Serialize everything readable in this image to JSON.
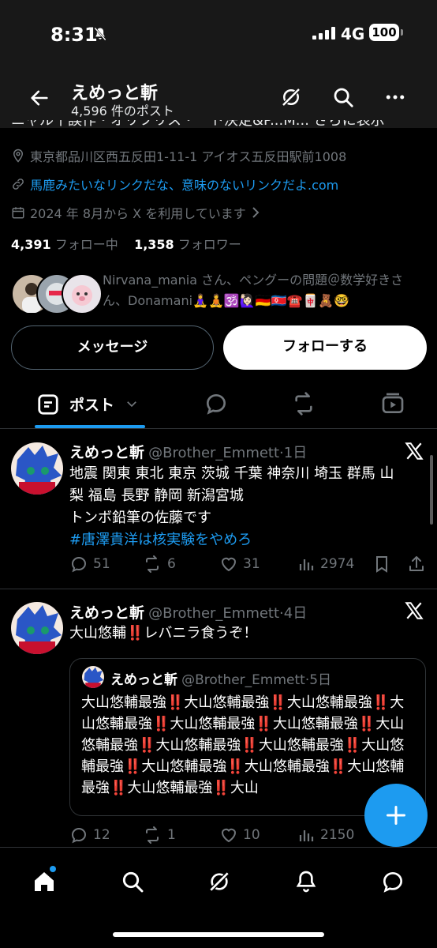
{
  "status_bar": {
    "time": "8:31",
    "network": "4G",
    "battery": "100"
  },
  "header": {
    "title": "えめっと斬",
    "subtitle": "4,596 件のポスト"
  },
  "profile": {
    "bio_cut": "ニャル十誤作・オリフリス・ート決定&P...M... さらに表示",
    "location": "東京都品川区西五反田1-11-1 アイオス五反田駅前1008",
    "website": "馬鹿みたいなリンクだな、意味のないリンクだよ.com",
    "joined": "2024 年 8月から X を利用しています",
    "following_count": "4,391",
    "following_label": "フォロー中",
    "followers_count": "1,358",
    "followers_label": "フォロワー",
    "followed_by": "Nirvana_mania さん、ペングーの問題＠数学好きさん、Donamani🧘‍♀️🧘🕉️🙋🏻‍♀️🇩🇪🇰🇵☎️🀄🧸🤓"
  },
  "buttons": {
    "message": "メッセージ",
    "follow": "フォローする"
  },
  "tabs": {
    "posts_label": "ポスト"
  },
  "posts": [
    {
      "name": "えめっと斬",
      "handle": "@Brother_Emmett",
      "time": "·1日",
      "lines": [
        "地震 関東 東北 東京 茨城 千葉 神奈川 埼玉 群馬 山",
        "梨 福島 長野 静岡 新潟宮城",
        "トンボ鉛筆の佐藤です"
      ],
      "hashtag": "#唐澤貴洋は核実験をやめろ",
      "replies": "51",
      "reposts": "6",
      "likes": "31",
      "views": "2974"
    },
    {
      "name": "えめっと斬",
      "handle": "@Brother_Emmett",
      "time": "·4日",
      "text": "大山悠輔‼️レバニラ食うぞ！",
      "quote": {
        "name": "えめっと斬",
        "handle": "@Brother_Emmett",
        "time": "·5日",
        "text": "大山悠輔最強‼️大山悠輔最強‼️大山悠輔最強‼️大山悠輔最強‼️大山悠輔最強‼️大山悠輔最強‼️大山悠輔最強‼️大山悠輔最強‼️大山悠輔最強‼️大山悠輔最強‼️大山悠輔最強‼️大山悠輔最強‼️大山悠輔最強‼️大山悠輔最強‼️大山"
      },
      "replies": "12",
      "reposts": "1",
      "likes": "10",
      "views": "2150"
    }
  ],
  "colors": {
    "accent": "#1d9bf0",
    "muted": "#71767b",
    "divider": "#2f3336",
    "header_bg": "#181818"
  },
  "icons": [
    "back-arrow-icon",
    "grok-icon",
    "search-icon",
    "more-icon",
    "location-icon",
    "link-icon",
    "calendar-icon",
    "x-logo-icon",
    "reply-icon",
    "repost-icon",
    "like-icon",
    "views-icon",
    "bookmark-icon",
    "share-icon",
    "home-icon",
    "bell-icon",
    "messages-icon",
    "plus-icon"
  ]
}
